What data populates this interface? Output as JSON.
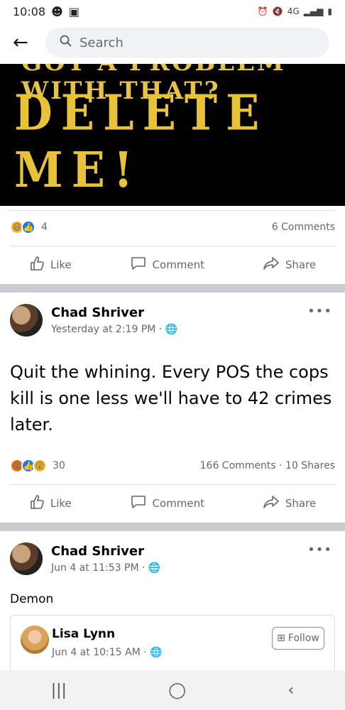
{
  "status": {
    "time": "10:08",
    "network": "4G"
  },
  "search": {
    "placeholder": "Search"
  },
  "post1": {
    "image_top_text": "GOT A PROBLEM WITH THAT?",
    "image_main_text": "DELETE ME!",
    "reaction_count": "4",
    "comments": "6 Comments"
  },
  "actions": {
    "like": "Like",
    "comment": "Comment",
    "share": "Share"
  },
  "post2": {
    "author": "Chad Shriver",
    "time": "Yesterday at 2:19 PM",
    "text": "Quit the whining. Every POS the cops kill is one less we'll have to 42 crimes later.",
    "reaction_count": "30",
    "stats": "166 Comments · 10 Shares"
  },
  "post3": {
    "author": "Chad Shriver",
    "time": "Jun 4 at 11:53 PM",
    "text": "Demon",
    "shared": {
      "author": "Lisa Lynn",
      "time": "Jun 4 at 10:15 AM",
      "follow_label": "Follow"
    }
  },
  "icons": [
    "back-arrow-icon",
    "search-icon",
    "globe-icon",
    "like-icon",
    "comment-icon",
    "share-icon",
    "more-icon"
  ],
  "colors": {
    "accent": "#1877f2",
    "gold": "#e8c33a"
  }
}
